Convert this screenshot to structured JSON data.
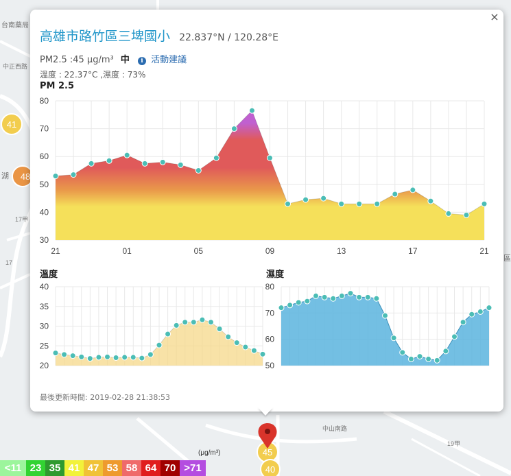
{
  "popup": {
    "close_glyph": "×",
    "title": "高雄市路竹區三埤國小",
    "coords": "22.837°N / 120.28°E",
    "pm_text": "PM2.5 :45 µg/m³",
    "pm_level": "中",
    "advice_label": "活動建議",
    "env_text": "溫度 : 22.37°C ,濕度 : 73%",
    "pm_section_title": "PM 2.5",
    "temp_section_title": "溫度",
    "hum_section_title": "濕度",
    "updated": "最後更新時間: 2019-02-28 21:38:53"
  },
  "chart_data": [
    {
      "type": "area",
      "title": "PM 2.5",
      "x": [
        "21",
        "22",
        "23",
        "00",
        "01",
        "02",
        "03",
        "04",
        "05",
        "06",
        "07",
        "08",
        "09",
        "10",
        "11",
        "12",
        "13",
        "14",
        "15",
        "16",
        "17",
        "18",
        "19",
        "20",
        "21"
      ],
      "x_tick_labels": [
        "21",
        "01",
        "05",
        "09",
        "13",
        "17",
        "21"
      ],
      "values": [
        53,
        53.5,
        57.5,
        58.5,
        60.5,
        57.5,
        58,
        57,
        55,
        59.5,
        70,
        76.5,
        59.5,
        43,
        44.5,
        45,
        43,
        43,
        43,
        46.5,
        48,
        44,
        39.5,
        39,
        43
      ],
      "ylim": [
        30,
        80
      ],
      "y_ticks": [
        30,
        40,
        50,
        60,
        70,
        80
      ],
      "grid": true,
      "color_scale": [
        "#f5e05a",
        "#e9984a",
        "#e05a5a",
        "#c060d0"
      ]
    },
    {
      "type": "area",
      "title": "溫度",
      "values": [
        23.2,
        22.8,
        22.5,
        22.2,
        21.8,
        22.1,
        22.2,
        22,
        22.1,
        22.1,
        21.9,
        22.8,
        25.2,
        28,
        30.2,
        31,
        31,
        31.6,
        31,
        29.3,
        27.3,
        25.8,
        24.7,
        23.8,
        22.9
      ],
      "ylim": [
        20,
        40
      ],
      "y_ticks": [
        20,
        25,
        30,
        35,
        40
      ],
      "grid": true,
      "color": "#f5d88a"
    },
    {
      "type": "area",
      "title": "濕度",
      "values": [
        72,
        73,
        74,
        74.5,
        76.5,
        76,
        75.5,
        76.5,
        77.5,
        76,
        76,
        75.5,
        69,
        60.5,
        55,
        52.5,
        53.5,
        52.5,
        52,
        55.5,
        61,
        66.5,
        69.5,
        70.5,
        72
      ],
      "ylim": [
        50,
        80
      ],
      "y_ticks": [
        50,
        60,
        70,
        80
      ],
      "grid": true,
      "color": "#5ab4de"
    }
  ],
  "map": {
    "markers": [
      {
        "label": "41",
        "color": "#f2cd4e"
      },
      {
        "label": "48",
        "color": "#ea9545"
      },
      {
        "label": "45",
        "color": "#f2cd4e"
      },
      {
        "label": "40",
        "color": "#f2cd4e"
      }
    ],
    "road_labels": [
      "17甲",
      "17",
      "19甲",
      "(μg/m³)",
      "台南藥局",
      "中正西路",
      "中山南路",
      "湖",
      "區"
    ]
  },
  "legend": {
    "unit": "(μg/m³)",
    "items": [
      {
        "label": "<11",
        "color": "#9cf59c"
      },
      {
        "label": "23",
        "color": "#32d332"
      },
      {
        "label": "35",
        "color": "#2e9a2e"
      },
      {
        "label": "41",
        "color": "#f2f23a"
      },
      {
        "label": "47",
        "color": "#f0c236"
      },
      {
        "label": "53",
        "color": "#ee9a2e"
      },
      {
        "label": "58",
        "color": "#ef6a6a"
      },
      {
        "label": "64",
        "color": "#e01e1e"
      },
      {
        "label": "70",
        "color": "#a00000"
      },
      {
        "label": ">71",
        "color": "#b44de0"
      }
    ]
  }
}
